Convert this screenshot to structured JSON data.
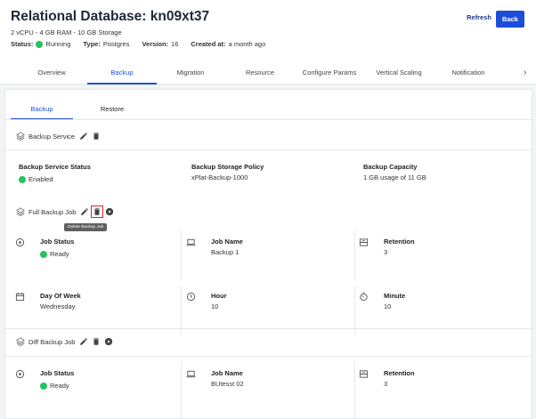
{
  "header": {
    "title": "Relational Database: kn09xt37",
    "specs": "2 vCPU - 4 GB RAM - 10 GB Storage",
    "status_label": "Status:",
    "status_value": "Running",
    "type_label": "Type:",
    "type_value": "Postgres",
    "version_label": "Version:",
    "version_value": "16",
    "created_label": "Created at:",
    "created_value": "a month ago",
    "refresh_label": "Refresh",
    "back_label": "Back"
  },
  "tabs": [
    "Overview",
    "Backup",
    "Migration",
    "Resource",
    "Configure Params",
    "Vertical Scaling",
    "Notification"
  ],
  "active_tab": "Backup",
  "subtabs": [
    "Backup",
    "Restore"
  ],
  "active_subtab": "Backup",
  "backup_service": {
    "title": "Backup Service",
    "fields": [
      {
        "label": "Backup Service Status",
        "value": "Enabled"
      },
      {
        "label": "Backup Storage Policy",
        "value": "xPlat-Backup-1000"
      },
      {
        "label": "Backup Capacity",
        "value": "1 GB usage of 11 GB"
      }
    ]
  },
  "full_backup_job": {
    "title": "Full Backup Job",
    "tooltip": "Delete Backup Job",
    "fields": [
      {
        "label": "Job Status",
        "value": "Ready",
        "icon": "target-icon"
      },
      {
        "label": "Job Name",
        "value": "Backup 1",
        "icon": "laptop-icon"
      },
      {
        "label": "Retention",
        "value": "3",
        "icon": "archive-icon"
      },
      {
        "label": "Day Of Week",
        "value": "Wednesday",
        "icon": "calendar-icon"
      },
      {
        "label": "Hour",
        "value": "10",
        "icon": "clock-icon"
      },
      {
        "label": "Minute",
        "value": "10",
        "icon": "timer-icon"
      }
    ]
  },
  "diff_backup_job": {
    "title": "Diff Backup Job",
    "fields": [
      {
        "label": "Job Status",
        "value": "Ready",
        "icon": "target-icon"
      },
      {
        "label": "Job Name",
        "value": "BUtesst 02",
        "icon": "laptop-icon"
      },
      {
        "label": "Retention",
        "value": "3",
        "icon": "archive-icon"
      }
    ]
  },
  "colors": {
    "accent": "#1d4ed8",
    "status_green": "#22c55e",
    "highlight": "#dc2626"
  }
}
